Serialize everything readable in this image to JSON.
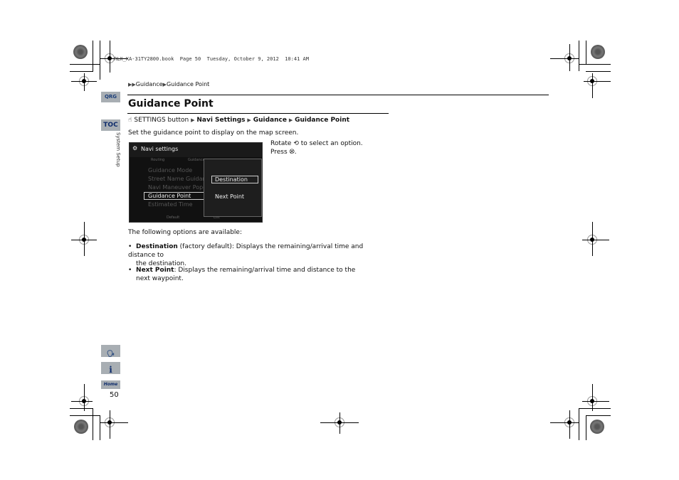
{
  "print_meta": "RLX_KA-31TY2800.book  Page 50  Tuesday, October 9, 2012  10:41 AM",
  "breadcrumb": {
    "prefix": "▶▶",
    "items": [
      "Guidance",
      "Guidance Point"
    ],
    "separator": "▶"
  },
  "sidebar": {
    "qrg_label": "QRG",
    "toc_label": "TOC",
    "section_label": "System Setup",
    "bottom_icons": [
      "voice-command-icon",
      "info-icon",
      "home-icon"
    ],
    "home_label": "Home",
    "page_number": "50"
  },
  "section": {
    "title": "Guidance Point",
    "path": {
      "icon": "hand-press-icon",
      "start": "SETTINGS button",
      "sep": "▶",
      "steps": [
        "Navi Settings",
        "Guidance",
        "Guidance Point"
      ]
    },
    "intro": "Set the guidance point to display on the map screen.",
    "instructions": {
      "line1_a": "Rotate",
      "line1_b": "to select an option.",
      "line2_a": "Press",
      "line2_b": "."
    },
    "options_intro": "The following options are available:",
    "options": [
      {
        "name": "Destination",
        "desc1": " (factory default): Displays the remaining/arrival time and distance to",
        "desc2": "the destination."
      },
      {
        "name": "Next Point",
        "desc1": ": Displays the remaining/arrival time and distance to the",
        "desc2": "next waypoint."
      }
    ]
  },
  "screen": {
    "header": "Navi settings",
    "tabs": [
      "Routing",
      "Guidance"
    ],
    "menu_items": [
      "Guidance Mode",
      "Street Name Guidance",
      "Navi Maneuver Pop-up",
      "Guidance Point",
      "Estimated Time"
    ],
    "selected_item": "Guidance Point",
    "footer_left": "Default",
    "footer_right": "List",
    "popup_options": [
      "Destination",
      "Next Point"
    ],
    "popup_selected": "Destination"
  }
}
